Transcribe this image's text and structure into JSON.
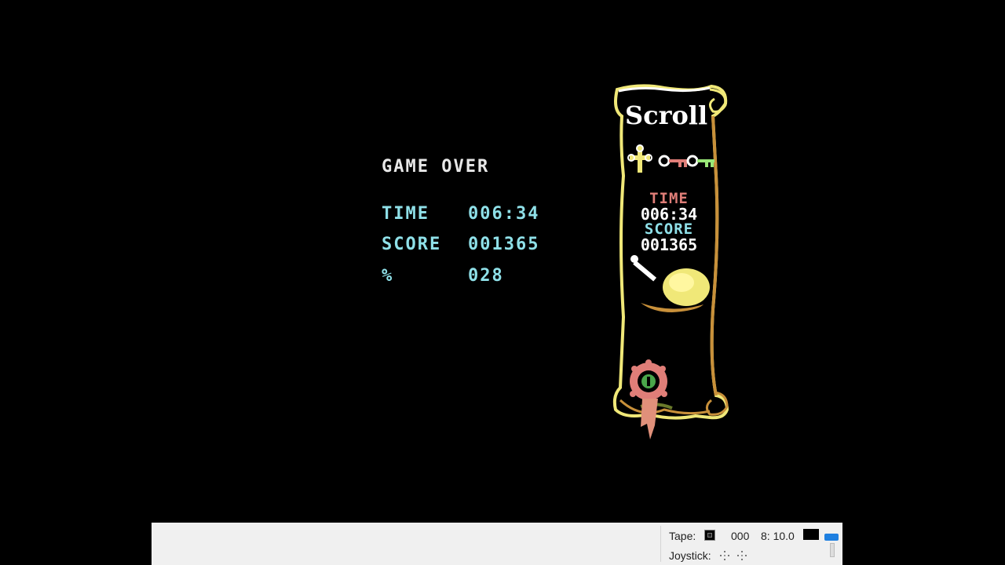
{
  "game": {
    "game_over": "GAME OVER",
    "time_label": "TIME",
    "time_value": "006:34",
    "score_label": "SCORE",
    "score_value": "001365",
    "percent_label": "%",
    "percent_value": "028"
  },
  "scroll": {
    "title": "Scroll",
    "time_label": "TIME",
    "time_value": "006:34",
    "score_label": "SCORE",
    "score_value": "001365"
  },
  "statusbar": {
    "tape_label": "Tape:",
    "tape_counter": "000",
    "drive_info": "8: 10.0",
    "joystick_label": "Joystick:"
  },
  "colors": {
    "cyan_text": "#8fe0e8",
    "white_text": "#e8e8e8",
    "scroll_yellow": "#f0e878",
    "scroll_brown": "#c8903a",
    "time_red": "#e07e78",
    "status_blue": "#1e7fe0"
  }
}
